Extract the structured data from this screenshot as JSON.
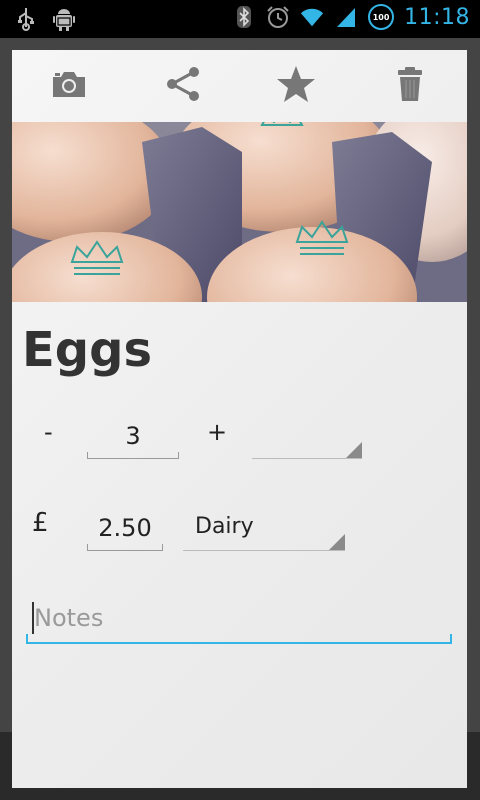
{
  "status_bar": {
    "time": "11:18",
    "battery_level": "100",
    "icons": [
      "usb-icon",
      "android-debug-icon",
      "bluetooth-icon",
      "alarm-icon",
      "wifi-icon",
      "signal-icon",
      "battery-icon"
    ]
  },
  "toolbar": {
    "actions": [
      "camera-icon",
      "share-icon",
      "star-icon",
      "trash-icon"
    ]
  },
  "item": {
    "title": "Eggs",
    "quantity": "3",
    "minus_label": "-",
    "plus_label": "+",
    "unit_value": "",
    "currency_symbol": "£",
    "price": "2.50",
    "category": "Dairy",
    "notes_placeholder": "Notes"
  },
  "colors": {
    "accent": "#33b5e5",
    "status_bar_bg": "#000000",
    "title_text": "#333333"
  }
}
